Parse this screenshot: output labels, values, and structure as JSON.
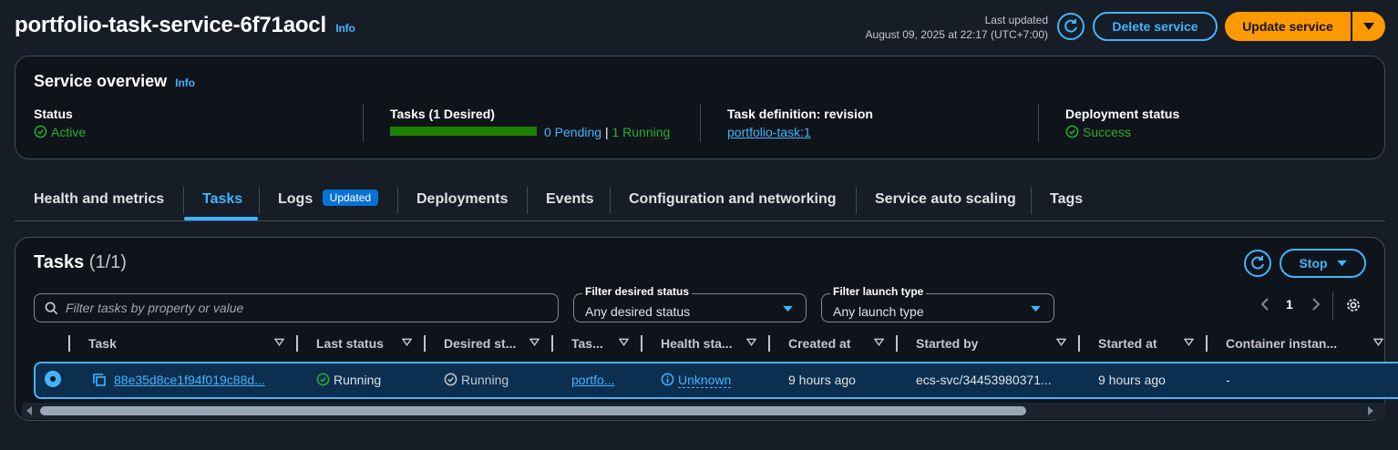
{
  "header": {
    "title": "portfolio-task-service-6f71aocl",
    "info": "Info",
    "last_updated_label": "Last updated",
    "last_updated_value": "August 09, 2025 at 22:17 (UTC+7:00)",
    "delete_label": "Delete service",
    "update_label": "Update service"
  },
  "overview": {
    "title": "Service overview",
    "info": "Info",
    "status_label": "Status",
    "status_value": "Active",
    "tasks_label": "Tasks (1 Desired)",
    "tasks_progress": 1.0,
    "pending": "0 Pending",
    "separator": "|",
    "running": "1 Running",
    "taskdef_label": "Task definition: revision",
    "taskdef_value": "portfolio-task:1",
    "deploy_label": "Deployment status",
    "deploy_value": "Success"
  },
  "tabs": [
    {
      "label": "Health and metrics"
    },
    {
      "label": "Tasks"
    },
    {
      "label": "Logs",
      "badge": "Updated"
    },
    {
      "label": "Deployments"
    },
    {
      "label": "Events"
    },
    {
      "label": "Configuration and networking"
    },
    {
      "label": "Service auto scaling"
    },
    {
      "label": "Tags"
    }
  ],
  "tasks_panel": {
    "title": "Tasks",
    "count": "(1/1)",
    "stop_label": "Stop",
    "search_placeholder": "Filter tasks by property or value",
    "filter_status_label": "Filter desired status",
    "filter_status_value": "Any desired status",
    "filter_launch_label": "Filter launch type",
    "filter_launch_value": "Any launch type",
    "page": "1",
    "columns": [
      "Task",
      "Last status",
      "Desired st...",
      "Tas...",
      "Health sta...",
      "Created at",
      "Started by",
      "Started at",
      "Container instan..."
    ],
    "row": {
      "task": "88e35d8ce1f94f019c88d...",
      "last_status": "Running",
      "desired_status": "Running",
      "task_def": "portfo...",
      "health": "Unknown",
      "created_at": "9 hours ago",
      "started_by": "ecs-svc/34453980371...",
      "started_at": "9 hours ago",
      "container_instance": "-"
    }
  },
  "colors": {
    "accent": "#42b4ff",
    "primary": "#ff9900",
    "success": "#29ad32"
  }
}
